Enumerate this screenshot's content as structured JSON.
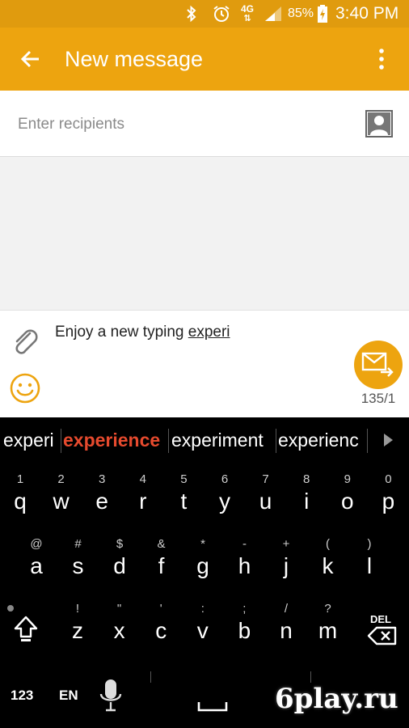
{
  "status_bar": {
    "network": "4G",
    "battery": "85%",
    "time": "3:40 PM"
  },
  "app_bar": {
    "title": "New message"
  },
  "recipients": {
    "placeholder": "Enter recipients"
  },
  "compose": {
    "text": "Enjoy a new typing ",
    "composing_word": "experi",
    "counter": "135/1"
  },
  "keyboard": {
    "suggestions": [
      "experi",
      "experience",
      "experiment",
      "experienc"
    ],
    "row1": [
      {
        "hint": "1",
        "key": "q"
      },
      {
        "hint": "2",
        "key": "w"
      },
      {
        "hint": "3",
        "key": "e"
      },
      {
        "hint": "4",
        "key": "r"
      },
      {
        "hint": "5",
        "key": "t"
      },
      {
        "hint": "6",
        "key": "y"
      },
      {
        "hint": "7",
        "key": "u"
      },
      {
        "hint": "8",
        "key": "i"
      },
      {
        "hint": "9",
        "key": "o"
      },
      {
        "hint": "0",
        "key": "p"
      }
    ],
    "row2": [
      {
        "hint": "@",
        "key": "a"
      },
      {
        "hint": "#",
        "key": "s"
      },
      {
        "hint": "$",
        "key": "d"
      },
      {
        "hint": "&",
        "key": "f"
      },
      {
        "hint": "*",
        "key": "g"
      },
      {
        "hint": "-",
        "key": "h"
      },
      {
        "hint": "+",
        "key": "j"
      },
      {
        "hint": "(",
        "key": "k"
      },
      {
        "hint": ")",
        "key": "l"
      }
    ],
    "row3": [
      {
        "hint": "!",
        "key": "z"
      },
      {
        "hint": "\"",
        "key": "x"
      },
      {
        "hint": "'",
        "key": "c"
      },
      {
        "hint": ":",
        "key": "v"
      },
      {
        "hint": ";",
        "key": "b"
      },
      {
        "hint": "/",
        "key": "n"
      },
      {
        "hint": "?",
        "key": "m"
      }
    ],
    "del_label": "DEL",
    "numbers_label": "123",
    "lang_label": "EN",
    "icons": [
      "shift-icon",
      "backspace-icon",
      "mic-icon",
      "space-icon",
      "arrow-right-icon"
    ]
  },
  "watermark": "6play.ru",
  "colors": {
    "status_bar": "#e09b0e",
    "app_bar": "#eda40f",
    "suggestion_highlight": "#e64a2e"
  }
}
